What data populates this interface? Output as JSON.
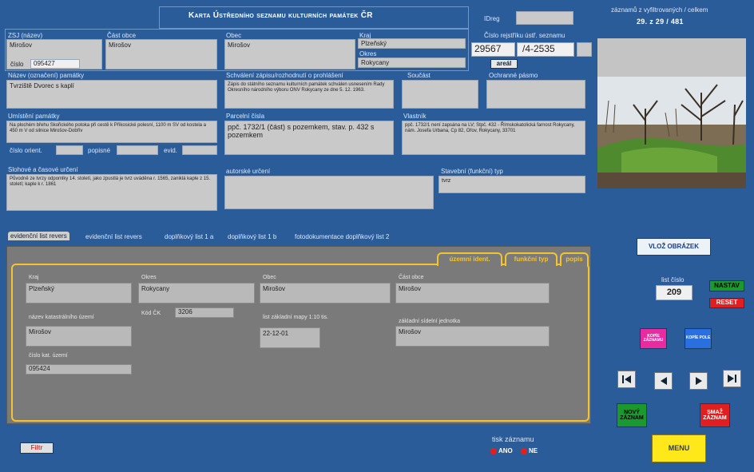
{
  "header": {
    "title": "Karta Ústředního seznamu kulturních památek ČR",
    "idreg_label": "IDreg",
    "idreg_value": "",
    "records_label": "záznamů z vyfiltrovaných / celkem",
    "records_value": "29. z 29 / 481"
  },
  "ident": {
    "zsj_label": "ZSJ (název)",
    "zsj_value": "Mirošov",
    "cast_obce_label": "Část obce",
    "cast_obce_value": "Mirošov",
    "obec_label": "Obec",
    "obec_value": "Mirošov",
    "kraj_label": "Kraj",
    "kraj_value": "Plzeňský",
    "okres_label": "Okres",
    "okres_value": "Rokycany",
    "cislo_label": "číslo",
    "cislo_value": "095427",
    "rejstrik_label": "Číslo rejstříku ústř. seznamu",
    "rejstrik_a": "29567",
    "rejstrik_b": "/4-2535",
    "areal_button": "areál"
  },
  "row2": {
    "nazev_label": "Název (označení) památky",
    "nazev_value": "Tvrziště Dvorec s kaplí",
    "schvaleni_label": "Schválení zápisu/rozhodnutí o prohlášení",
    "schvaleni_value": "Zápis do státního seznamu kulturních památek schválen usnesením Rady Okresního národního výboru ONV Rokycany ze dne 5. 12. 1963.",
    "soucast_label": "Součást",
    "ochranne_label": "Ochranné pásmo"
  },
  "row3": {
    "umisteni_label": "Umístění památky",
    "umisteni_value": "Na plochém břehu Skořického potoka při cestě k Příkosické polesní, 1100 m SV od kostela a 450 m V od silnice Mirošov-Dobřív",
    "parcelni_label": "Parcelní čísla",
    "parcelni_value": "ppč. 1732/1 (část) s pozemkem, stav. p. 432 s pozemkem",
    "vlastnik_label": "Vlastník",
    "vlastnik_value": "ppč. 1732/1 není zapsána na LV; Stpč. 432 - Římskokatolická farnost Rokycany, nám. Josefa Urbana, Cp 82, Ořov, Rokycany, 33701",
    "cislo_orient_label": "číslo orient.",
    "popisne_label": "popisné",
    "evid_label": "evid."
  },
  "row4": {
    "stoh_label": "Slohové a časové určení",
    "stoh_value": "Původně ze tvrzy odpomlky 14. století, jako zpustlá je tvrz uváděna r. 1565, zaniklá kaple z 15. století; kaple k r. 1861",
    "autorske_label": "autorské určení",
    "autorske_value": "",
    "stavebni_label": "Stavební (funkční) typ",
    "stavebni_value": "tvrz"
  },
  "tabs": [
    "evidenční list revers",
    "evidenční list revers",
    "doplňkový list 1 a",
    "doplňkový list 1 b",
    "fotodokumentace doplňkový list 2"
  ],
  "subtabs": [
    "územní ident.",
    "funkční typ",
    "popis"
  ],
  "inner": {
    "kraj_label": "Kraj",
    "kraj_value": "Plzeňský",
    "okres_label": "Okres",
    "okres_value": "Rokycany",
    "obec_label": "Obec",
    "obec_value": "Mirošov",
    "cast_label": "Část obce",
    "cast_value": "Mirošov",
    "katastr_label": "název katastrálního území",
    "katastr_value": "Mirošov",
    "kodku_label": "Kód ČK",
    "kodku_value": "3206",
    "mapa_label": "list základní mapy 1:10 tis.",
    "mapa_value": "22-12-01",
    "zsj_label": "základní sídelní jednotka",
    "zsj_value": "Mirošov",
    "cislo_kat_label": "číslo kat. území",
    "cislo_kat_value": "095424"
  },
  "right": {
    "vloz_obrazek": "VLOŽ OBRÁZEK",
    "list_cislo_label": "list číslo",
    "list_cislo_value": "209",
    "nastav": "NASTAV",
    "reset": "RESET",
    "kopie_zaznam": "KOPÍE ZÁZNAMU",
    "kopie_pole": "KOPÍE POLE",
    "novy_zaznam": "NOVÝ ZÁZNAM",
    "smaz_zaznam": "SMAŽ ZÁZNAM",
    "menu": "MENU"
  },
  "footer": {
    "left_button": "Filtr",
    "left_red_text": "",
    "tisk_label": "tisk záznamu",
    "ano": "ANO",
    "ne": "NE"
  },
  "colors": {
    "background": "#2a5c9a",
    "field": "#c9c9c9",
    "panel": "#7a7a7a",
    "tab_yellow": "#f4c430"
  }
}
